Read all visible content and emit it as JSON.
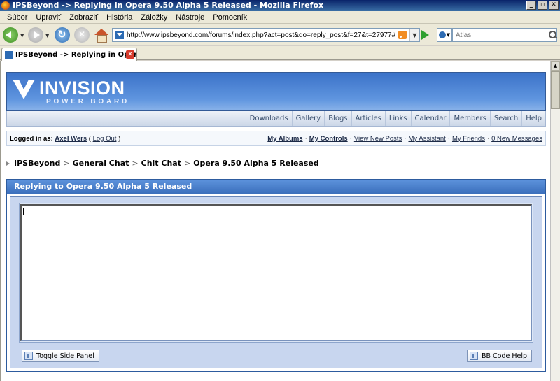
{
  "window": {
    "title": "IPSBeyond -> Replying in Opera 9.50 Alpha 5 Released - Mozilla Firefox",
    "controls": [
      "_",
      "▫",
      "✕"
    ]
  },
  "menu": [
    "Súbor",
    "Upraviť",
    "Zobraziť",
    "História",
    "Záložky",
    "Nástroje",
    "Pomocník"
  ],
  "toolbar": {
    "url": "http://www.ipsbeyond.com/forums/index.php?act=post&do=reply_post&f=27&t=27977#",
    "search_placeholder": "Atlas"
  },
  "tab": {
    "label": "IPSBeyond -> Replying in Opera ...",
    "close": "✕"
  },
  "forum": {
    "logo_title": "INVISION",
    "logo_subtitle": "POWER BOARD",
    "nav": [
      "Downloads",
      "Gallery",
      "Blogs",
      "Articles",
      "Links",
      "Calendar",
      "Members",
      "Search",
      "Help"
    ],
    "user": {
      "logged_in_label": "Logged in as:",
      "username": "Axel Wers",
      "logout_prefix": "(",
      "logout": "Log Out",
      "logout_suffix": ")"
    },
    "user_links": {
      "albums": "My Albums",
      "controls": "My Controls",
      "new_posts": "View New Posts",
      "assistant": "My Assistant",
      "friends": "My Friends",
      "messages": "0 New Messages"
    },
    "breadcrumb": [
      "IPSBeyond",
      "General Chat",
      "Chit Chat",
      "Opera 9.50 Alpha 5 Released"
    ],
    "breadcrumb_sep": ">",
    "panel_title": "Replying to Opera 9.50 Alpha 5 Released",
    "editor": {
      "value": "",
      "toggle_button": "Toggle Side Panel",
      "help_button": "BB Code Help"
    }
  },
  "colors": {
    "titlebar": "#0a246a",
    "banner": "#3b72c8",
    "panel_header": "#3b6fbc"
  }
}
